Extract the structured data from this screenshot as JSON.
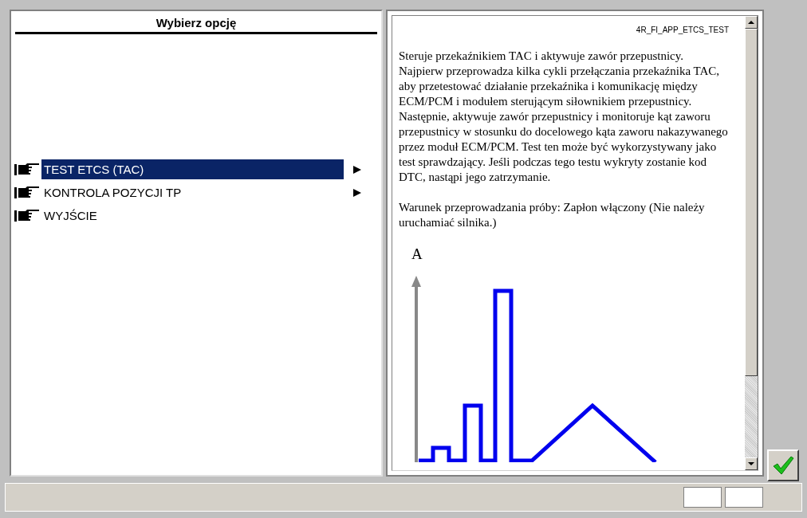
{
  "menu": {
    "title": "Wybierz opcję",
    "items": [
      {
        "label": "TEST ETCS (TAC)",
        "selected": true,
        "has_submenu": true
      },
      {
        "label": "KONTROLA POZYCJI TP",
        "selected": false,
        "has_submenu": true
      },
      {
        "label": "WYJŚCIE",
        "selected": false,
        "has_submenu": false
      }
    ]
  },
  "description": {
    "code": "4R_FI_APP_ETCS_TEST",
    "paragraphs": [
      "Steruje przekaźnikiem TAC i aktywuje zawór przepustnicy. Najpierw przeprowadza kilka cykli przełączania przekaźnika TAC, aby przetestować działanie przekaźnika i komunikację między ECM/PCM i modułem sterującym siłownikiem przepustnicy. Następnie, aktywuje zawór przepustnicy i monitoruje kąt zaworu przepustnicy w stosunku do docelowego kąta zaworu nakazywanego przez moduł ECM/PCM. Test ten może być wykorzystywany jako test sprawdzający. Jeśli podczas tego testu wykryty zostanie kod DTC, nastąpi jego zatrzymanie.",
      "Warunek przeprowadzania próby: Zapłon włączony (Nie należy uruchamiać silnika.)"
    ],
    "axis_label": "A"
  }
}
